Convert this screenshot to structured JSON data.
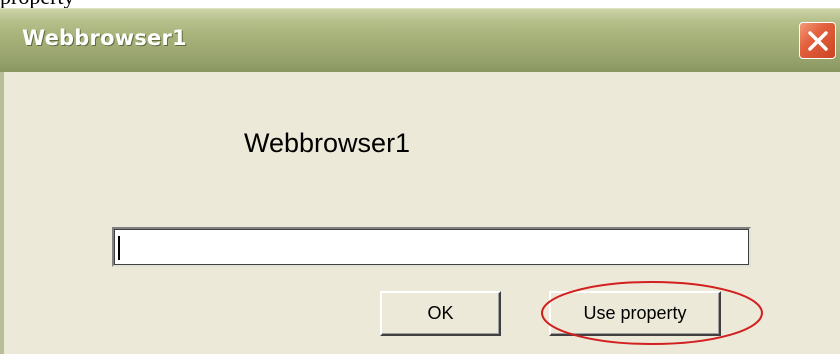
{
  "top_fragment": "property",
  "window": {
    "title": "Webbrowser1",
    "close_icon": "close-x-icon",
    "title_bar_color": "#a3ae78",
    "close_color": "#d9532f",
    "body_color": "#ece9d8"
  },
  "dialog": {
    "heading": "Webbrowser1",
    "input": {
      "value": "",
      "placeholder": ""
    },
    "buttons": {
      "ok_label": "OK",
      "use_property_label": "Use property"
    }
  },
  "annotation": {
    "type": "ellipse",
    "color": "#d22020",
    "target": "use-property-button"
  }
}
